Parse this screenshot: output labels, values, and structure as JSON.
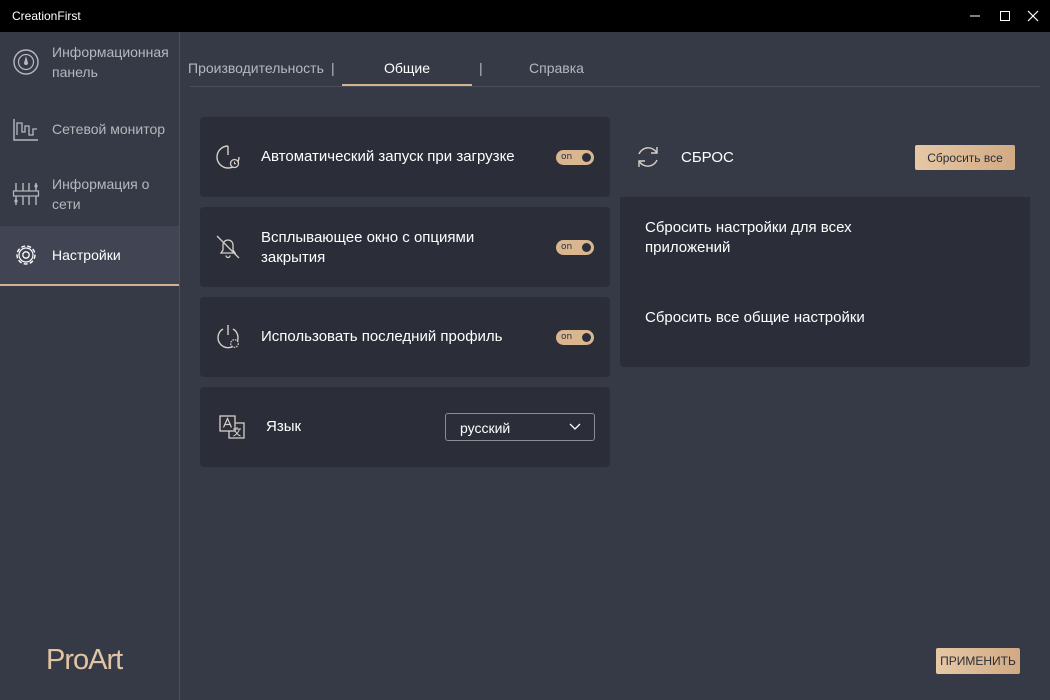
{
  "window": {
    "title": "CreationFirst"
  },
  "sidebar": {
    "items": [
      {
        "label": "Информационная панель",
        "icon": "dashboard-gauge-icon"
      },
      {
        "label": "Сетевой монитор",
        "icon": "network-monitor-icon"
      },
      {
        "label": "Информация о сети",
        "icon": "network-info-icon"
      },
      {
        "label": "Настройки",
        "icon": "gear-icon",
        "active": true
      }
    ],
    "logo": "ProArt"
  },
  "tabs": {
    "items": [
      "Производительность",
      "Общие",
      "Справка"
    ],
    "separator": "|",
    "active": "Общие"
  },
  "settings": {
    "auto_start": {
      "label": "Автоматический запуск при загрузке",
      "toggle": "on",
      "icon": "startup-timer-icon"
    },
    "close_popup": {
      "label_line1": "Всплывающее окно с опциями",
      "label_line2": "закрытия",
      "toggle": "on",
      "icon": "bell-off-icon"
    },
    "last_profile": {
      "label": "Использовать последний профиль",
      "toggle": "on",
      "icon": "profile-power-icon"
    },
    "language": {
      "label": "Язык",
      "value": "русский",
      "icon": "translate-icon"
    }
  },
  "reset": {
    "title": "СБРОС",
    "reset_all_label": "Сбросить все",
    "items": [
      {
        "line1": "Сбросить настройки для всех",
        "line2": "приложений"
      },
      {
        "line1": "Сбросить все общие настройки"
      }
    ]
  },
  "footer": {
    "apply_label": "ПРИМЕНИТЬ"
  },
  "colors": {
    "accent": "#d1b291",
    "background": "#363a46",
    "card": "#2b2e38"
  }
}
